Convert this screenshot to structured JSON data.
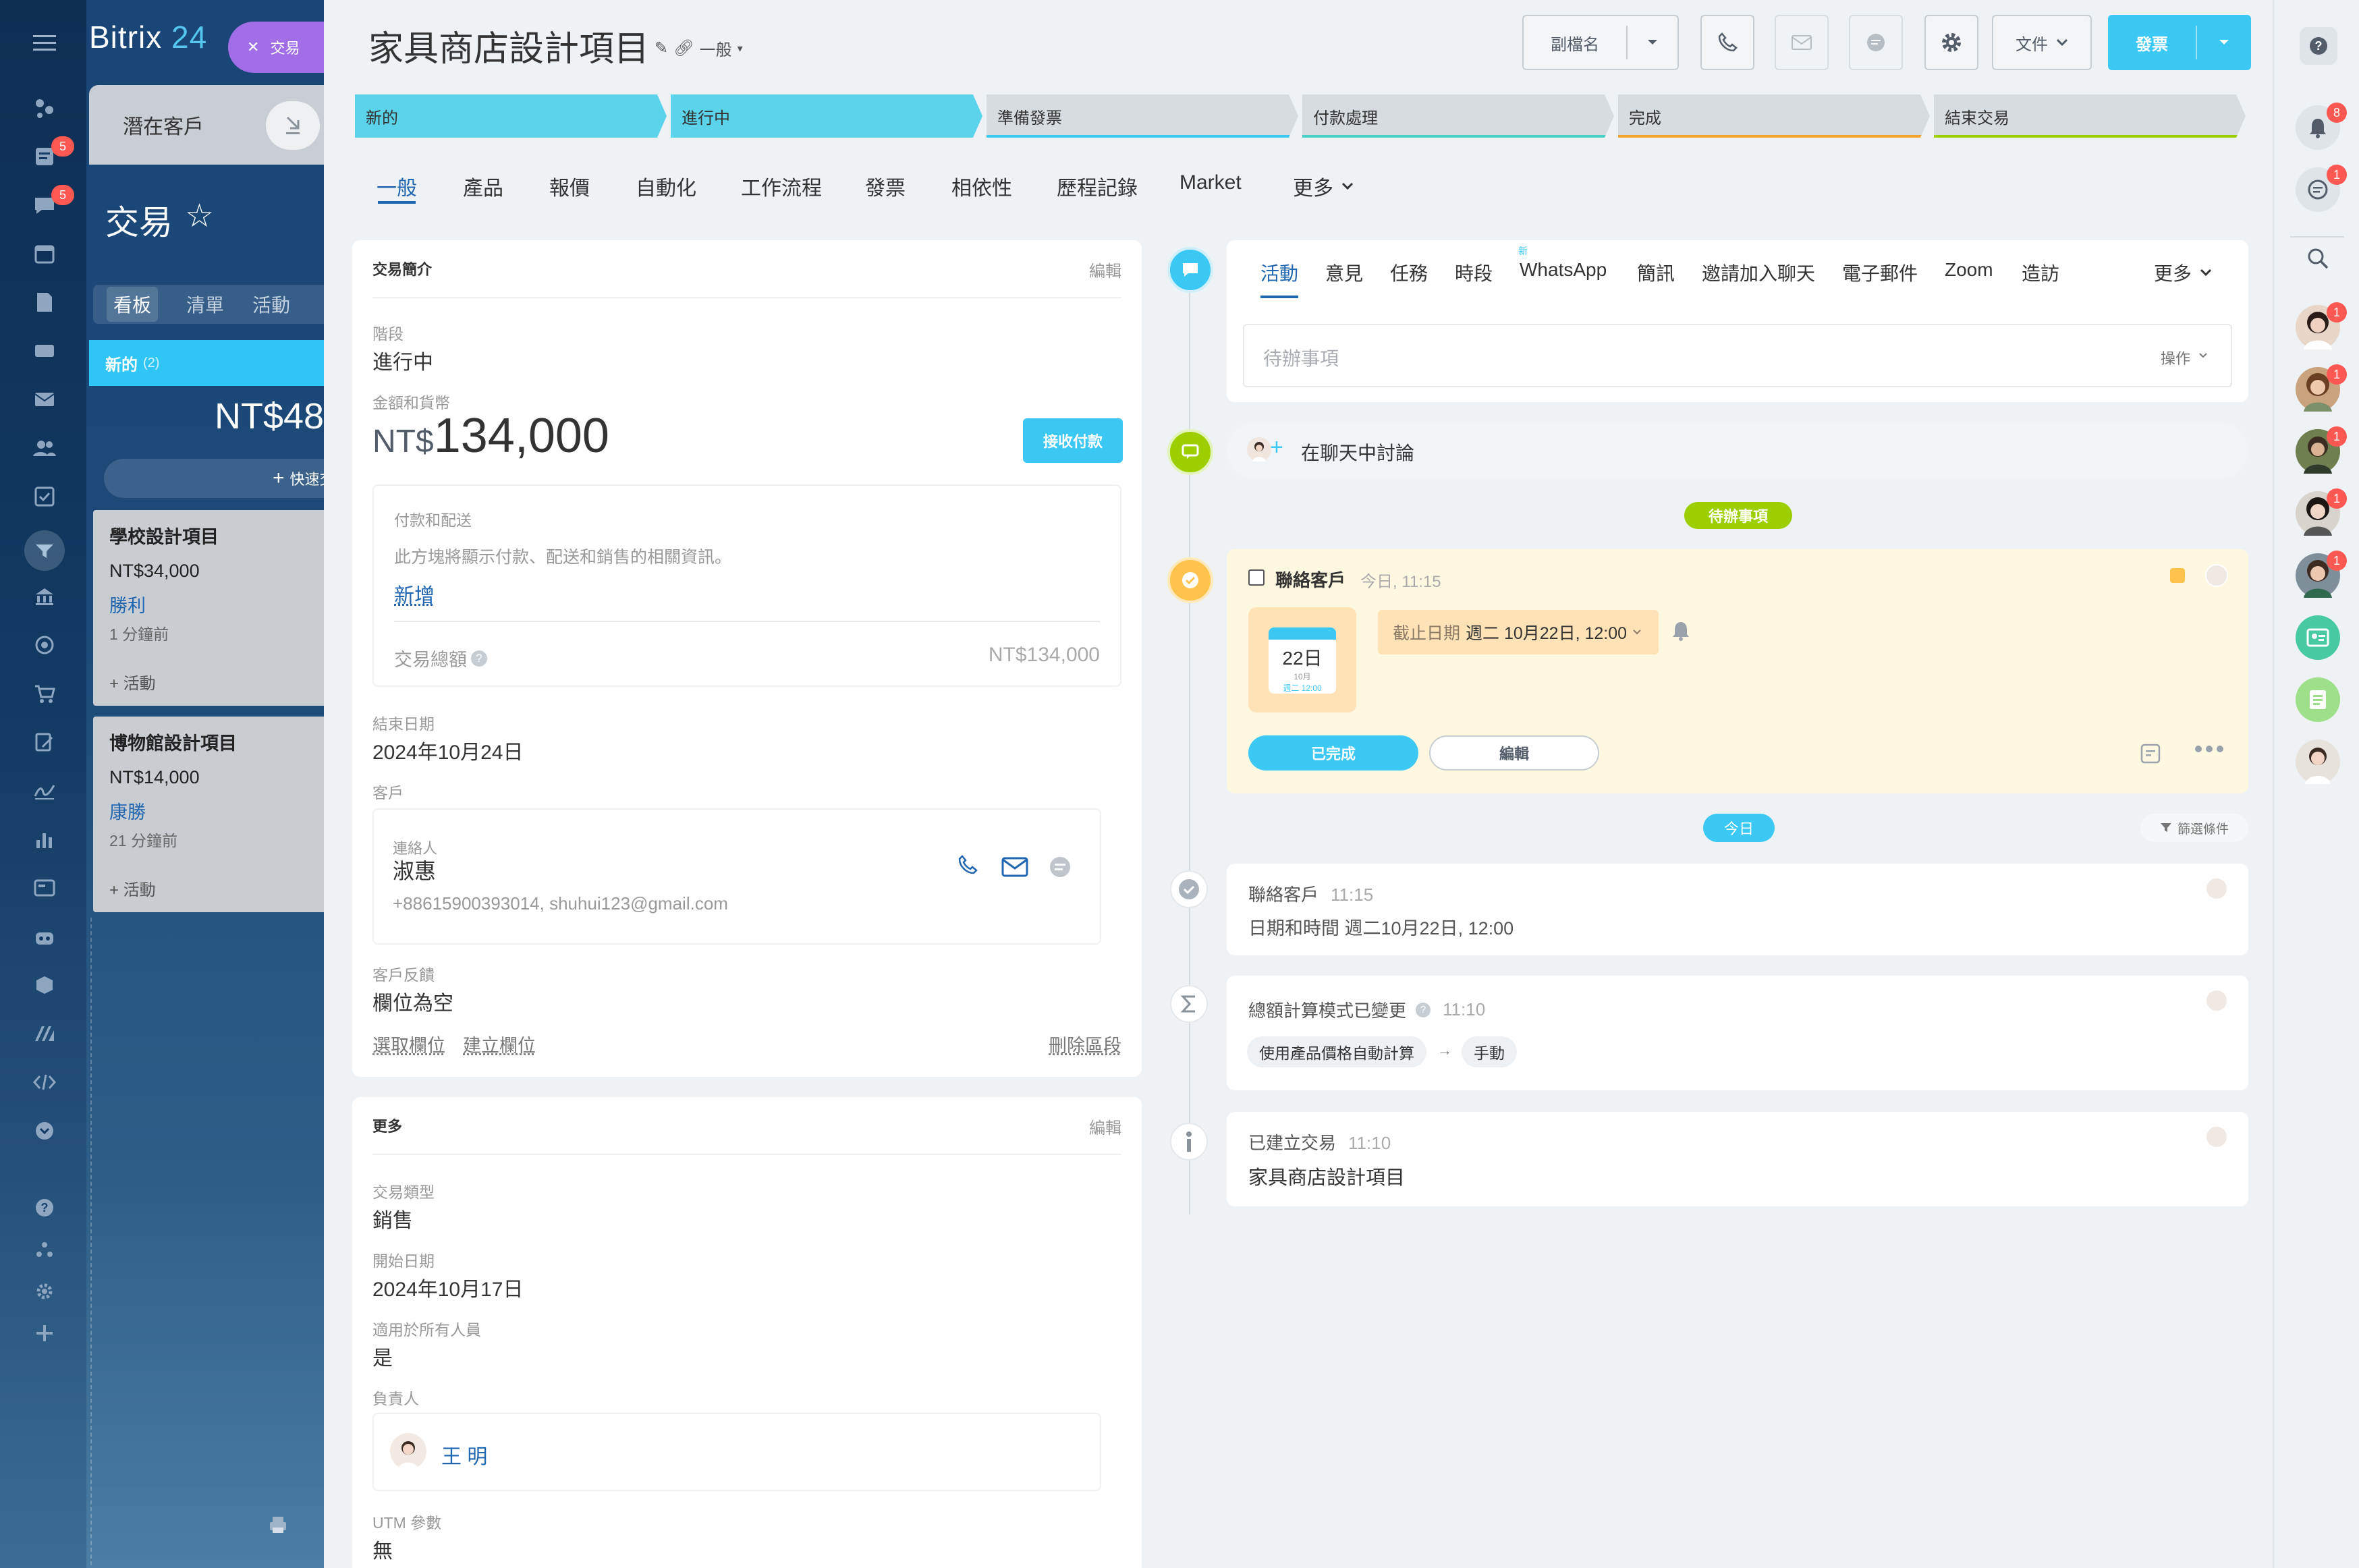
{
  "app": {
    "brand": "Bitrix",
    "brand_num": "24",
    "deal_pill": "交易",
    "left_badges": [
      "5",
      "5"
    ]
  },
  "crm_bg": {
    "lead_tab": "潛在客戶",
    "deals_title": "交易",
    "view_tabs": [
      "看板",
      "清單",
      "活動"
    ],
    "column_title": "新的",
    "column_count": "(2)",
    "column_amount": "NT$48",
    "quick_add": "快速交",
    "cards": [
      {
        "title": "學校設計項目",
        "amount": "NT$34,000",
        "company": "勝利",
        "time": "1 分鐘前",
        "activity": "+ 活動"
      },
      {
        "title": "博物館設計項目",
        "amount": "NT$14,000",
        "company": "康勝",
        "time": "21 分鐘前",
        "activity": "+ 活動"
      }
    ]
  },
  "header": {
    "title": "家具商店設計項目",
    "category": "一般",
    "alias_btn": "副檔名",
    "docs_btn": "文件",
    "invoice_btn": "發票"
  },
  "stages": [
    "新的",
    "進行中",
    "準備發票",
    "付款處理",
    "完成",
    "結束交易"
  ],
  "colors": {
    "accent": "#2fc6f6",
    "stage_done": "#5bd3ea",
    "brand": "#2066b0",
    "success": "#9dcf00",
    "todo": "#ffc34d"
  },
  "tabs": [
    "一般",
    "產品",
    "報價",
    "自動化",
    "工作流程",
    "發票",
    "相依性",
    "歷程記錄",
    "Market",
    "更多"
  ],
  "about": {
    "heading": "交易簡介",
    "edit": "編輯",
    "stage_label": "階段",
    "stage_value": "進行中",
    "amount_label": "金額和貨幣",
    "currency": "NT$",
    "amount": "134,000",
    "receive_payment": "接收付款",
    "payment_title": "付款和配送",
    "payment_desc": "此方塊將顯示付款、配送和銷售的相關資訊。",
    "payment_add": "新增",
    "total_label": "交易總額",
    "total_value": "NT$134,000",
    "close_date_label": "結束日期",
    "close_date": "2024年10月24日",
    "client_label": "客戶",
    "contact_label": "連絡人",
    "contact_name": "淑惠",
    "contact_info": "+88615900393014, shuhui123@gmail.com",
    "feedback_label": "客戶反饋",
    "feedback_value": "欄位為空",
    "select_field": "選取欄位",
    "create_field": "建立欄位",
    "delete_section": "刪除區段"
  },
  "more": {
    "heading": "更多",
    "edit": "編輯",
    "type_label": "交易類型",
    "type_value": "銷售",
    "start_label": "開始日期",
    "start_value": "2024年10月17日",
    "public_label": "適用於所有人員",
    "public_value": "是",
    "owner_label": "負責人",
    "owner_name": "王 明",
    "utm_label": "UTM 參數",
    "utm_value": "無"
  },
  "timeline": {
    "tabs": [
      "活動",
      "意見",
      "任務",
      "時段",
      "WhatsApp",
      "簡訊",
      "邀請加入聊天",
      "電子郵件",
      "Zoom",
      "造訪",
      "更多"
    ],
    "new_badge": "新",
    "todo_placeholder": "待辦事項",
    "actions": "操作",
    "chat_discuss": "在聊天中討論",
    "todo_section": "待辦事項",
    "todo_item": {
      "title": "聯絡客戶",
      "time": "今日, 11:15",
      "cal_day": "22日",
      "cal_month": "10月",
      "cal_sub": "週二 12:00",
      "deadline_label": "截止日期",
      "deadline_value": "週二 10月22日, 12:00",
      "done_btn": "已完成",
      "edit_btn": "編輯"
    },
    "today": "今日",
    "filter": "篩選條件",
    "history": [
      {
        "title": "聯絡客戶",
        "time": "11:15",
        "line": "日期和時間 週二10月22日, 12:00"
      },
      {
        "title": "總額計算模式已變更",
        "time": "11:10",
        "from": "使用產品價格自動計算",
        "arrow": "→",
        "to": "手動"
      },
      {
        "title": "已建立交易",
        "time": "11:10",
        "line": "家具商店設計項目"
      }
    ]
  },
  "rightbar": {
    "notif_badge": "8",
    "chat_badge": "1",
    "avatar_badges": [
      "1",
      "1",
      "1",
      "1",
      "1"
    ]
  }
}
